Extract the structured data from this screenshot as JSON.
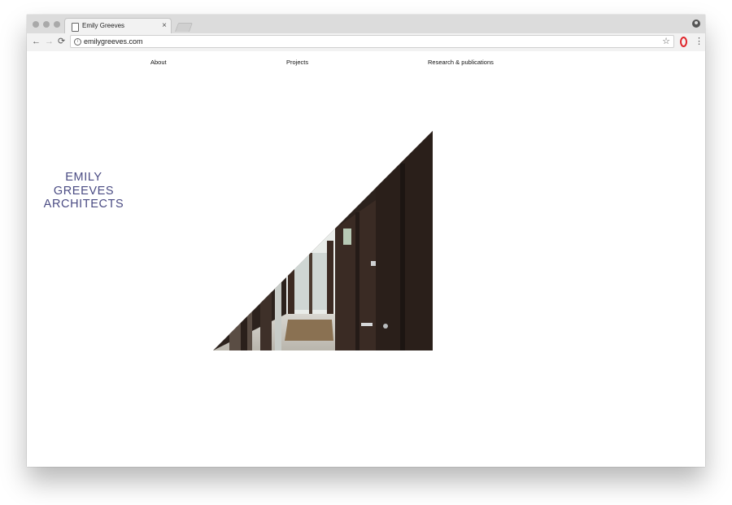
{
  "browser": {
    "tab_title": "Emily Greeves",
    "tab_close": "×",
    "url": "emilygreeves.com",
    "icons": {
      "doc": "document-icon",
      "profile": "profile-icon",
      "back": "←",
      "forward": "→",
      "reload": "⟳",
      "info": "i",
      "star": "☆",
      "menu": "⋮",
      "opera": "opera-icon"
    }
  },
  "site": {
    "nav": [
      {
        "label": "About"
      },
      {
        "label": "Projects"
      },
      {
        "label": "Research & publications"
      }
    ],
    "logo_lines": [
      "EMILY",
      "GREEVES",
      "ARCHITECTS"
    ],
    "logo_color": "#4a4b83",
    "hero_image": "triangular photo of a dark wooden doorway corridor"
  }
}
